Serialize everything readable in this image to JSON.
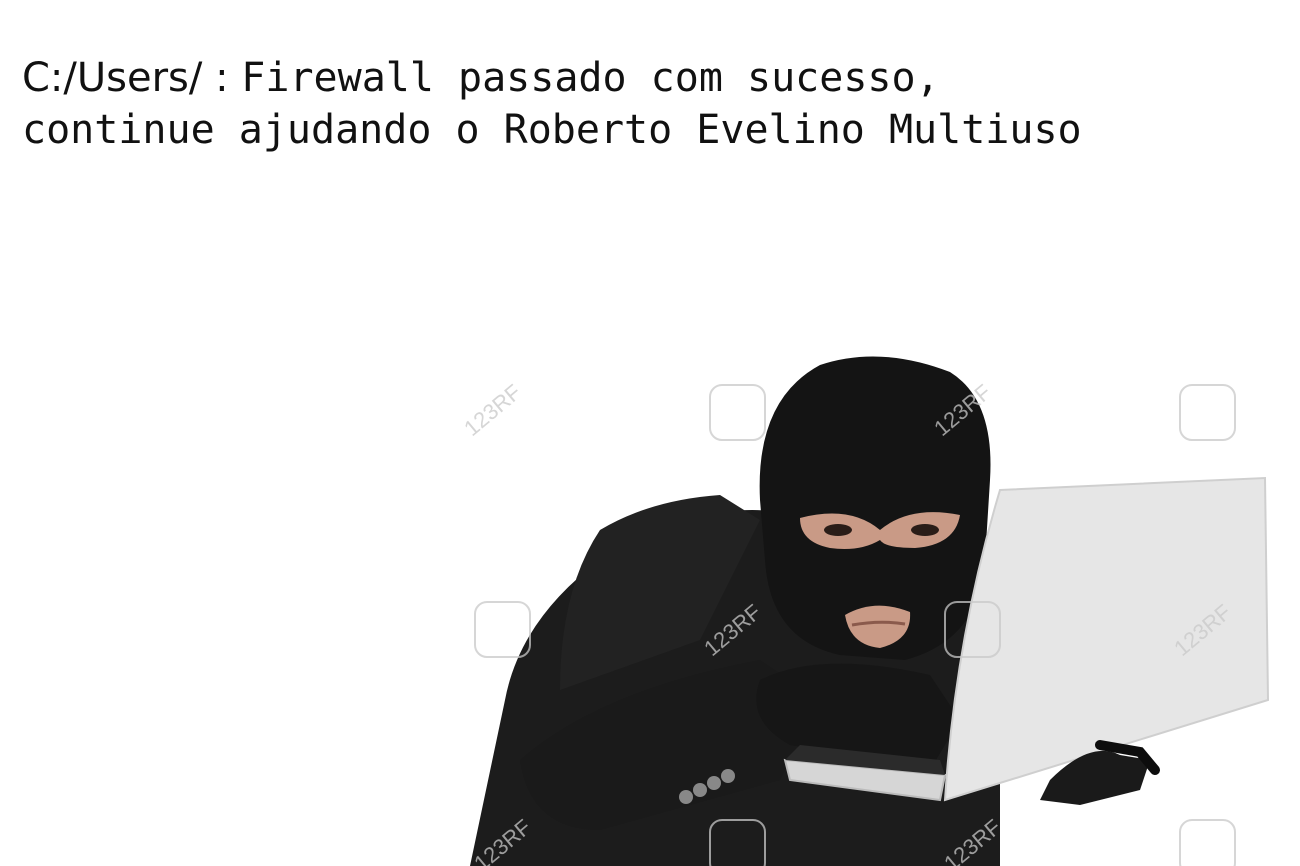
{
  "caption": {
    "prompt": "C:/Users/ : ",
    "line1": "Firewall passado com sucesso,",
    "line2": "continue ajudando o Roberto Evelino Multiuso"
  },
  "image": {
    "subject": "masked hacker in black suit holding a laptop",
    "watermark_text": "123RF",
    "colors": {
      "background": "#ffffff",
      "mask": "#141414",
      "suit": "#1c1c1c",
      "laptop": "#e6e6e6",
      "skin": "#c99a86"
    }
  }
}
